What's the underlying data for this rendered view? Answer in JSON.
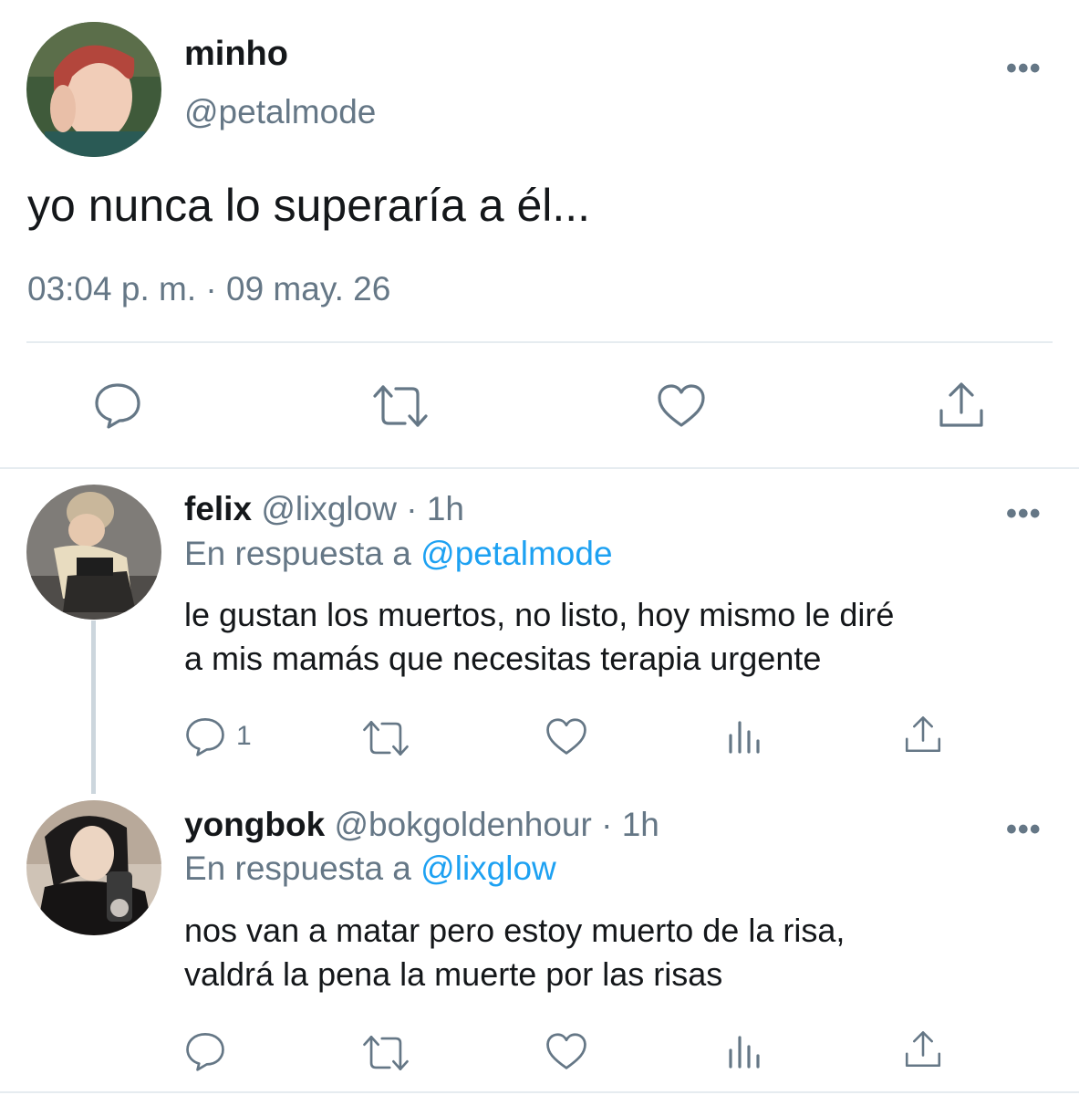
{
  "main_tweet": {
    "name": "minho",
    "handle": "@petalmode",
    "text": "yo nunca lo superaría a él...",
    "timestamp": "03:04 p. m. · 09 may. 26",
    "more": "•••"
  },
  "replies": [
    {
      "name": "felix",
      "handle": "@lixglow",
      "dot": "·",
      "time": "1h",
      "reply_prefix": "En respuesta a",
      "reply_to": "@petalmode",
      "text_line1": "le gustan los muertos, no listo, hoy mismo le diré",
      "text_line2": "a mis mamás que necesitas terapia urgente",
      "reply_count": "1",
      "more": "•••"
    },
    {
      "name": "yongbok",
      "handle": "@bokgoldenhour",
      "dot": "·",
      "time": "1h",
      "reply_prefix": "En respuesta a",
      "reply_to": "@lixglow",
      "text_line1": "nos van a matar pero estoy muerto de la risa,",
      "text_line2": "valdrá la pena la muerte por las risas",
      "reply_count": "",
      "more": "•••"
    }
  ],
  "icons": {
    "reply": "reply-icon",
    "retweet": "retweet-icon",
    "like": "heart-icon",
    "share": "share-icon",
    "analytics": "analytics-icon"
  },
  "colors": {
    "link": "#1da1f2",
    "muted": "#657786",
    "divider": "#e6ecf0"
  }
}
